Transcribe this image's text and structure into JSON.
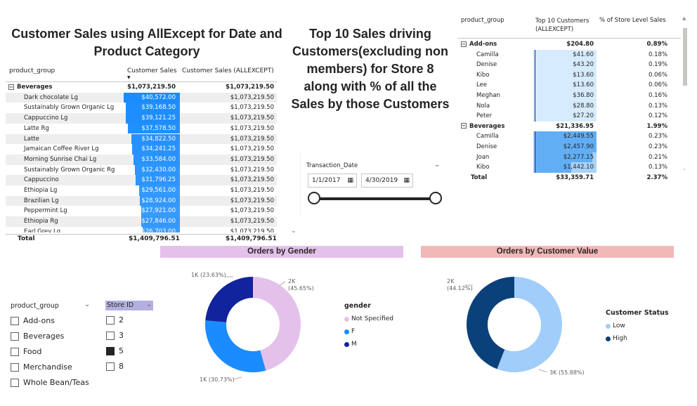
{
  "left_title": "Customer Sales using AllExcept for Date and Product Category",
  "middle_title": "Top 10 Sales driving Customers(excluding non members) for Store 8 along with % of all the Sales by those Customers",
  "left_table": {
    "headers": [
      "product_group",
      "Customer Sales",
      "Customer Sales (ALLEXCEPT)"
    ],
    "group": {
      "name": "Beverages",
      "sales": "$1,073,219.50",
      "allexcept": "$1,073,219.50"
    },
    "rows": [
      {
        "name": "Dark chocolate Lg",
        "sales": "$40,572.00",
        "allexcept": "$1,073,219.50",
        "value": 40572
      },
      {
        "name": "Sustainably Grown Organic Lg",
        "sales": "$39,168.50",
        "allexcept": "$1,073,219.50",
        "value": 39168.5
      },
      {
        "name": "Cappuccino Lg",
        "sales": "$39,121.25",
        "allexcept": "$1,073,219.50",
        "value": 39121.25
      },
      {
        "name": "Latte Rg",
        "sales": "$37,578.50",
        "allexcept": "$1,073,219.50",
        "value": 37578.5
      },
      {
        "name": "Latte",
        "sales": "$34,822.50",
        "allexcept": "$1,073,219.50",
        "value": 34822.5
      },
      {
        "name": "Jamaican Coffee River Lg",
        "sales": "$34,241.25",
        "allexcept": "$1,073,219.50",
        "value": 34241.25
      },
      {
        "name": "Morning Sunrise Chai Lg",
        "sales": "$33,584.00",
        "allexcept": "$1,073,219.50",
        "value": 33584
      },
      {
        "name": "Sustainably Grown Organic Rg",
        "sales": "$32,430.00",
        "allexcept": "$1,073,219.50",
        "value": 32430
      },
      {
        "name": "Cappuccino",
        "sales": "$31,796.25",
        "allexcept": "$1,073,219.50",
        "value": 31796.25
      },
      {
        "name": "Ethiopia Lg",
        "sales": "$29,561.00",
        "allexcept": "$1,073,219.50",
        "value": 29561
      },
      {
        "name": "Brazilian Lg",
        "sales": "$28,924.00",
        "allexcept": "$1,073,219.50",
        "value": 28924
      },
      {
        "name": "Peppermint Lg",
        "sales": "$27,921.00",
        "allexcept": "$1,073,219.50",
        "value": 27921
      },
      {
        "name": "Ethiopia Rg",
        "sales": "$27,846.00",
        "allexcept": "$1,073,219.50",
        "value": 27846
      },
      {
        "name": "Earl Grey Lg",
        "sales": "$26,703.00",
        "allexcept": "$1,073,219.50",
        "value": 26703
      }
    ],
    "total": {
      "label": "Total",
      "sales": "$1,409,796.51",
      "allexcept": "$1,409,796.51"
    }
  },
  "date_slicer": {
    "label": "Transaction_Date",
    "start": "1/1/2017",
    "end": "4/30/2019",
    "range_fraction": [
      0,
      1
    ]
  },
  "right_table": {
    "headers": [
      "product_group",
      "Top 10 Customers (ALLEXCEPT)",
      "% of Store Level Sales"
    ],
    "rows": [
      {
        "kind": "group",
        "name": "Add-ons",
        "value": "$204.80",
        "pct": "0.89%"
      },
      {
        "kind": "item",
        "group": "addons",
        "name": "Camilla",
        "value": "$41.60",
        "pct": "0.18%",
        "amount": 41.6
      },
      {
        "kind": "item",
        "group": "addons",
        "name": "Denise",
        "value": "$43.20",
        "pct": "0.19%",
        "amount": 43.2
      },
      {
        "kind": "item",
        "group": "addons",
        "name": "Kibo",
        "value": "$13.60",
        "pct": "0.06%",
        "amount": 13.6
      },
      {
        "kind": "item",
        "group": "addons",
        "name": "Lee",
        "value": "$13.60",
        "pct": "0.06%",
        "amount": 13.6
      },
      {
        "kind": "item",
        "group": "addons",
        "name": "Meghan",
        "value": "$36.80",
        "pct": "0.16%",
        "amount": 36.8
      },
      {
        "kind": "item",
        "group": "addons",
        "name": "Nola",
        "value": "$28.80",
        "pct": "0.13%",
        "amount": 28.8
      },
      {
        "kind": "item",
        "group": "addons",
        "name": "Peter",
        "value": "$27.20",
        "pct": "0.12%",
        "amount": 27.2
      },
      {
        "kind": "group",
        "name": "Beverages",
        "value": "$21,336.95",
        "pct": "1.99%"
      },
      {
        "kind": "item",
        "group": "bev",
        "name": "Camilla",
        "value": "$2,449.55",
        "pct": "0.23%",
        "amount": 2449.55
      },
      {
        "kind": "item",
        "group": "bev",
        "name": "Denise",
        "value": "$2,457.90",
        "pct": "0.23%",
        "amount": 2457.9
      },
      {
        "kind": "item",
        "group": "bev",
        "name": "Joan",
        "value": "$2,277.15",
        "pct": "0.21%",
        "amount": 2277.15
      },
      {
        "kind": "item",
        "group": "bev",
        "name": "Kibo",
        "value": "$1,442.10",
        "pct": "0.13%",
        "amount": 1442.1
      },
      {
        "kind": "total",
        "name": "Total",
        "value": "$33,359.71",
        "pct": "2.37%"
      }
    ]
  },
  "gender_chart": {
    "band_title": "Orders by Gender",
    "legend_title": "gender",
    "colors": [
      "#e4c1ea",
      "#1a8cff",
      "#12239e"
    ],
    "chart_data": {
      "type": "pie",
      "categories": [
        "Not Specified",
        "F",
        "M"
      ],
      "values": [
        45.65,
        30.73,
        23.63
      ],
      "data_labels": [
        "2K (45.65%)",
        "1K (30.73%)",
        "1K (23.63%)"
      ]
    }
  },
  "value_chart": {
    "band_title": "Orders by Customer Value",
    "legend_title": "Customer Status",
    "colors": [
      "#a0cdfa",
      "#0b417a"
    ],
    "chart_data": {
      "type": "pie",
      "categories": [
        "Low",
        "High"
      ],
      "values": [
        55.88,
        44.12
      ],
      "data_labels": [
        "3K (55.88%)",
        "2K (44.12%)"
      ]
    }
  },
  "product_slicer": {
    "title": "product_group",
    "items": [
      {
        "label": "Add-ons",
        "checked": false
      },
      {
        "label": "Beverages",
        "checked": false
      },
      {
        "label": "Food",
        "checked": false
      },
      {
        "label": "Merchandise",
        "checked": false
      },
      {
        "label": "Whole Bean/Teas",
        "checked": false
      }
    ]
  },
  "store_slicer": {
    "title": "Store ID",
    "items": [
      {
        "label": "2",
        "checked": false
      },
      {
        "label": "3",
        "checked": false
      },
      {
        "label": "5",
        "checked": true
      },
      {
        "label": "8",
        "checked": false
      }
    ]
  }
}
